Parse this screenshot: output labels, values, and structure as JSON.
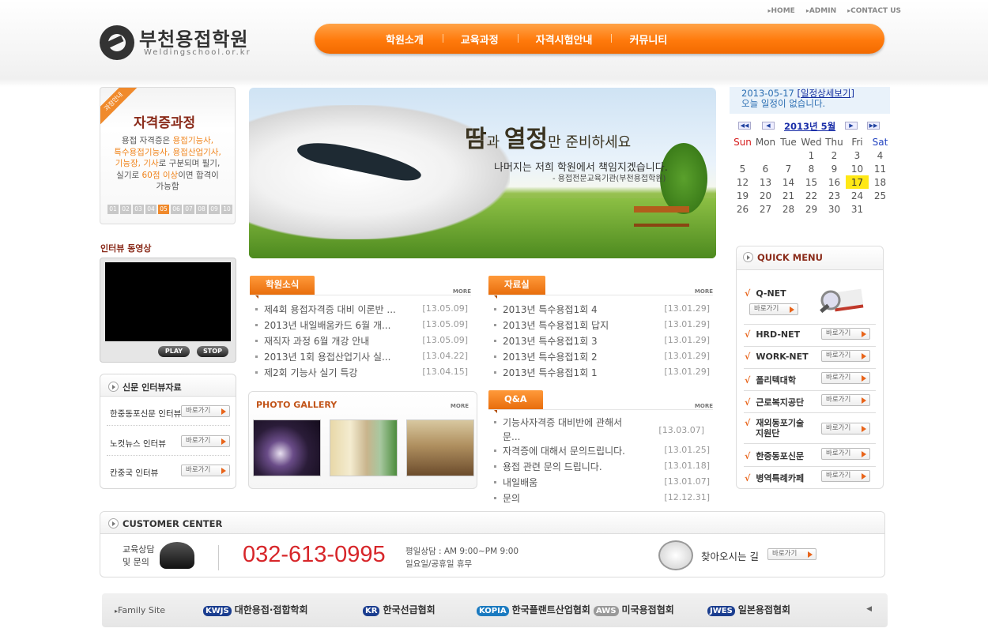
{
  "header": {
    "logo_name": "부천용접학원",
    "logo_url": "Weldingschool.or.kr",
    "top_links": [
      "HOME",
      "ADMIN",
      "CONTACT US"
    ],
    "nav": [
      "학원소개",
      "교육과정",
      "자격시험안내",
      "커뮤니티"
    ]
  },
  "cert_box": {
    "ribbon": "과정안내",
    "title": "자격증과정",
    "desc_1": "용접 자격증은 ",
    "desc_2": "용접기능사,",
    "desc_3": "특수용접기능사, 용접산업기사,",
    "desc_4": "기능장, 기사",
    "desc_5": "로 구분되며 필기,",
    "desc_6": "실기로 ",
    "desc_7": "60점 이상",
    "desc_8": "이면 합격이",
    "desc_9": "가능함",
    "pages": [
      "01",
      "02",
      "03",
      "04",
      "05",
      "06",
      "07",
      "08",
      "09",
      "10"
    ],
    "active_page": "05"
  },
  "video": {
    "label": "인터뷰 동영상",
    "play": "PLAY",
    "stop": "STOP"
  },
  "news": {
    "title": "신문 인터뷰자료",
    "items": [
      "한중동포신문 인터뷰",
      "노컷뉴스 인터뷰",
      "칸중국 인터뷰"
    ],
    "go_label": "바로가기"
  },
  "banner": {
    "headline_1": "땀",
    "headline_2": "과 ",
    "headline_3": "열정",
    "headline_4": "만 준비하세요",
    "sub": "나머지는 저희 학원에서 책임지겠습니다.",
    "sign": "- 용접전문교육기관(부천용접학원)"
  },
  "boards": {
    "academy": {
      "title": "학원소식",
      "more": "MORE",
      "items": [
        {
          "t": "제4회 용접자격증 대비 이론반 ...",
          "d": "[13.05.09]"
        },
        {
          "t": "2013년 내일배움카드 6월 개...",
          "d": "[13.05.09]"
        },
        {
          "t": "재직자 과정 6월 개강 안내",
          "d": "[13.05.09]"
        },
        {
          "t": "2013년 1회 용접산업기사 실...",
          "d": "[13.04.22]"
        },
        {
          "t": "제2회 기능사 실기 특강",
          "d": "[13.04.15]"
        }
      ]
    },
    "data": {
      "title": "자료실",
      "more": "MORE",
      "items": [
        {
          "t": "2013년 특수용접1회 4",
          "d": "[13.01.29]"
        },
        {
          "t": "2013년 특수용접1회 답지",
          "d": "[13.01.29]"
        },
        {
          "t": "2013년 특수용접1회 3",
          "d": "[13.01.29]"
        },
        {
          "t": "2013년 특수용접1회 2",
          "d": "[13.01.29]"
        },
        {
          "t": "2013년 특수용접1회 1",
          "d": "[13.01.29]"
        }
      ]
    },
    "qna": {
      "title": "Q&A",
      "more": "MORE",
      "items": [
        {
          "t": "기능사자격증 대비반에 관해서",
          "t2": "문...",
          "d": "[13.03.07]"
        },
        {
          "t": "자격증에 대해서 문의드립니다.",
          "d": "[13.01.25]"
        },
        {
          "t": "용접 관련 문의 드립니다.",
          "d": "[13.01.18]"
        },
        {
          "t": "내일배움",
          "d": "[13.01.07]"
        },
        {
          "t": "문의",
          "d": "[12.12.31]"
        }
      ]
    }
  },
  "gallery": {
    "title": "PHOTO GALLERY",
    "more": "MORE"
  },
  "calendar": {
    "date": "2013-05-17",
    "detail_link": "[일정상세보기]",
    "no_event": "오늘 일정이 없습니다.",
    "year_month": "2013년 5월",
    "weekdays": [
      "Sun",
      "Mon",
      "Tue",
      "Wed",
      "Thu",
      "Fri",
      "Sat"
    ],
    "weeks": [
      [
        "",
        "",
        "",
        "1",
        "2",
        "3",
        "4"
      ],
      [
        "5",
        "6",
        "7",
        "8",
        "9",
        "10",
        "11"
      ],
      [
        "12",
        "13",
        "14",
        "15",
        "16",
        "17",
        "18"
      ],
      [
        "19",
        "20",
        "21",
        "22",
        "23",
        "24",
        "25"
      ],
      [
        "26",
        "27",
        "28",
        "29",
        "30",
        "31",
        ""
      ]
    ],
    "today": "17",
    "highlight_color": "#ffe816"
  },
  "quick_menu": {
    "title": "QUICK MENU",
    "go_label": "바로가기",
    "items": [
      "Q-NET",
      "HRD-NET",
      "WORK-NET",
      "폴리텍대학",
      "근로복지공단",
      "재외동포기술",
      "한중동포신문",
      "병역특례카페"
    ],
    "item6_line2": "지원단"
  },
  "customer": {
    "title": "CUSTOMER CENTER",
    "label_1": "교육상담",
    "label_2": "및 문의",
    "tel": "032-613-0995",
    "hours_1": "평일상담 : AM 9:00~PM 9:00",
    "hours_2": "일요일/공휴일 휴무",
    "way": "찾아오시는 길",
    "go_label": "바로가기"
  },
  "family": {
    "label": "Family Site",
    "orgs": [
      {
        "logo": "KWJS",
        "name": "대한용접·접합학회"
      },
      {
        "logo": "KR",
        "name": "한국선급협회"
      },
      {
        "logo": "KOPIA",
        "name": "한국플랜트산업협회"
      },
      {
        "logo": "AWS",
        "name": "미국용접협회"
      },
      {
        "logo": "JWES",
        "name": "일본용접협회"
      }
    ]
  },
  "colors": {
    "accent": "#ff7a0c",
    "tel": "#d7262a",
    "link": "#1530a0"
  }
}
